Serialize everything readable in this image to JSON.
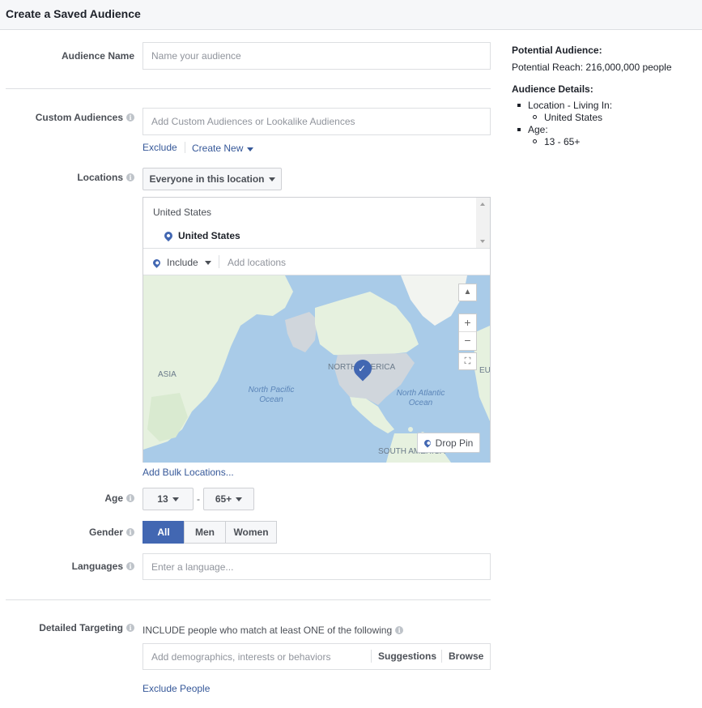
{
  "header": {
    "title": "Create a Saved Audience"
  },
  "audience_name": {
    "label": "Audience Name",
    "placeholder": "Name your audience"
  },
  "custom_audiences": {
    "label": "Custom Audiences",
    "placeholder": "Add Custom Audiences or Lookalike Audiences",
    "exclude_link": "Exclude",
    "create_new_link": "Create New"
  },
  "locations": {
    "label": "Locations",
    "dropdown": "Everyone in this location",
    "group_header": "United States",
    "selected_item": "United States",
    "include_label": "Include",
    "add_placeholder": "Add locations",
    "bulk_link": "Add Bulk Locations...",
    "map": {
      "labels": [
        "ASIA",
        "NORTH AMERICA",
        "North Pacific Ocean",
        "North Atlantic Ocean",
        "SOUTH AMERICA",
        "EU"
      ],
      "drop_pin": "Drop Pin",
      "zoom_in": "+",
      "zoom_out": "−"
    }
  },
  "age": {
    "label": "Age",
    "min": "13",
    "max": "65+",
    "separator": "-"
  },
  "gender": {
    "label": "Gender",
    "options": [
      "All",
      "Men",
      "Women"
    ],
    "selected": "All"
  },
  "languages": {
    "label": "Languages",
    "placeholder": "Enter a language..."
  },
  "detailed_targeting": {
    "label": "Detailed Targeting",
    "include_text": "INCLUDE people who match at least ONE of the following",
    "placeholder": "Add demographics, interests or behaviors",
    "suggestions": "Suggestions",
    "browse": "Browse",
    "exclude_link": "Exclude People"
  },
  "summary": {
    "potential_title": "Potential Audience:",
    "potential_reach": "Potential Reach: 216,000,000 people",
    "details_title": "Audience Details:",
    "location_item": "Location - Living In:",
    "location_value": "United States",
    "age_item": "Age:",
    "age_value": "13 - 65+"
  },
  "colors": {
    "accent": "#4267b2",
    "link": "#365899",
    "border": "#dddfe2"
  }
}
